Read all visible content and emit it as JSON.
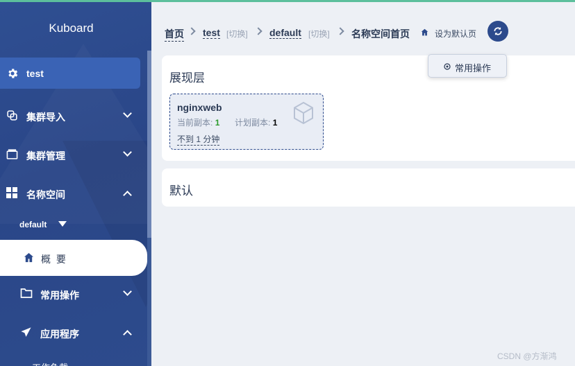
{
  "app": {
    "logo": "Kuboard"
  },
  "sidebar": {
    "cluster": "test",
    "menu": {
      "cluster_import": "集群导入",
      "cluster_manage": "集群管理",
      "namespace": "名称空间",
      "namespace_selected": "default",
      "overview": "概 要",
      "common_ops": "常用操作",
      "applications": "应用程序",
      "workloads": "工作负载"
    }
  },
  "breadcrumb": {
    "home": "首页",
    "cluster": "test",
    "cluster_switch": "[切换]",
    "namespace": "default",
    "namespace_switch": "[切换]",
    "current": "名称空间首页",
    "set_default": "设为默认页"
  },
  "tooltip": {
    "label": "常用操作"
  },
  "panels": {
    "presentation": {
      "title": "展现层",
      "workload": {
        "name": "nginxweb",
        "current_label": "当前副本:",
        "current_value": "1",
        "planned_label": "计划副本:",
        "planned_value": "1",
        "age": "不到 1 分钟"
      }
    },
    "default": {
      "title": "默认"
    }
  },
  "watermark": "CSDN @方渐鸿",
  "colors": {
    "sidebar": "#2b4a8a",
    "accent": "#3a63b5",
    "topline": "#5cbf9c",
    "text": "#2b3a55",
    "green": "#2b9a2b"
  }
}
